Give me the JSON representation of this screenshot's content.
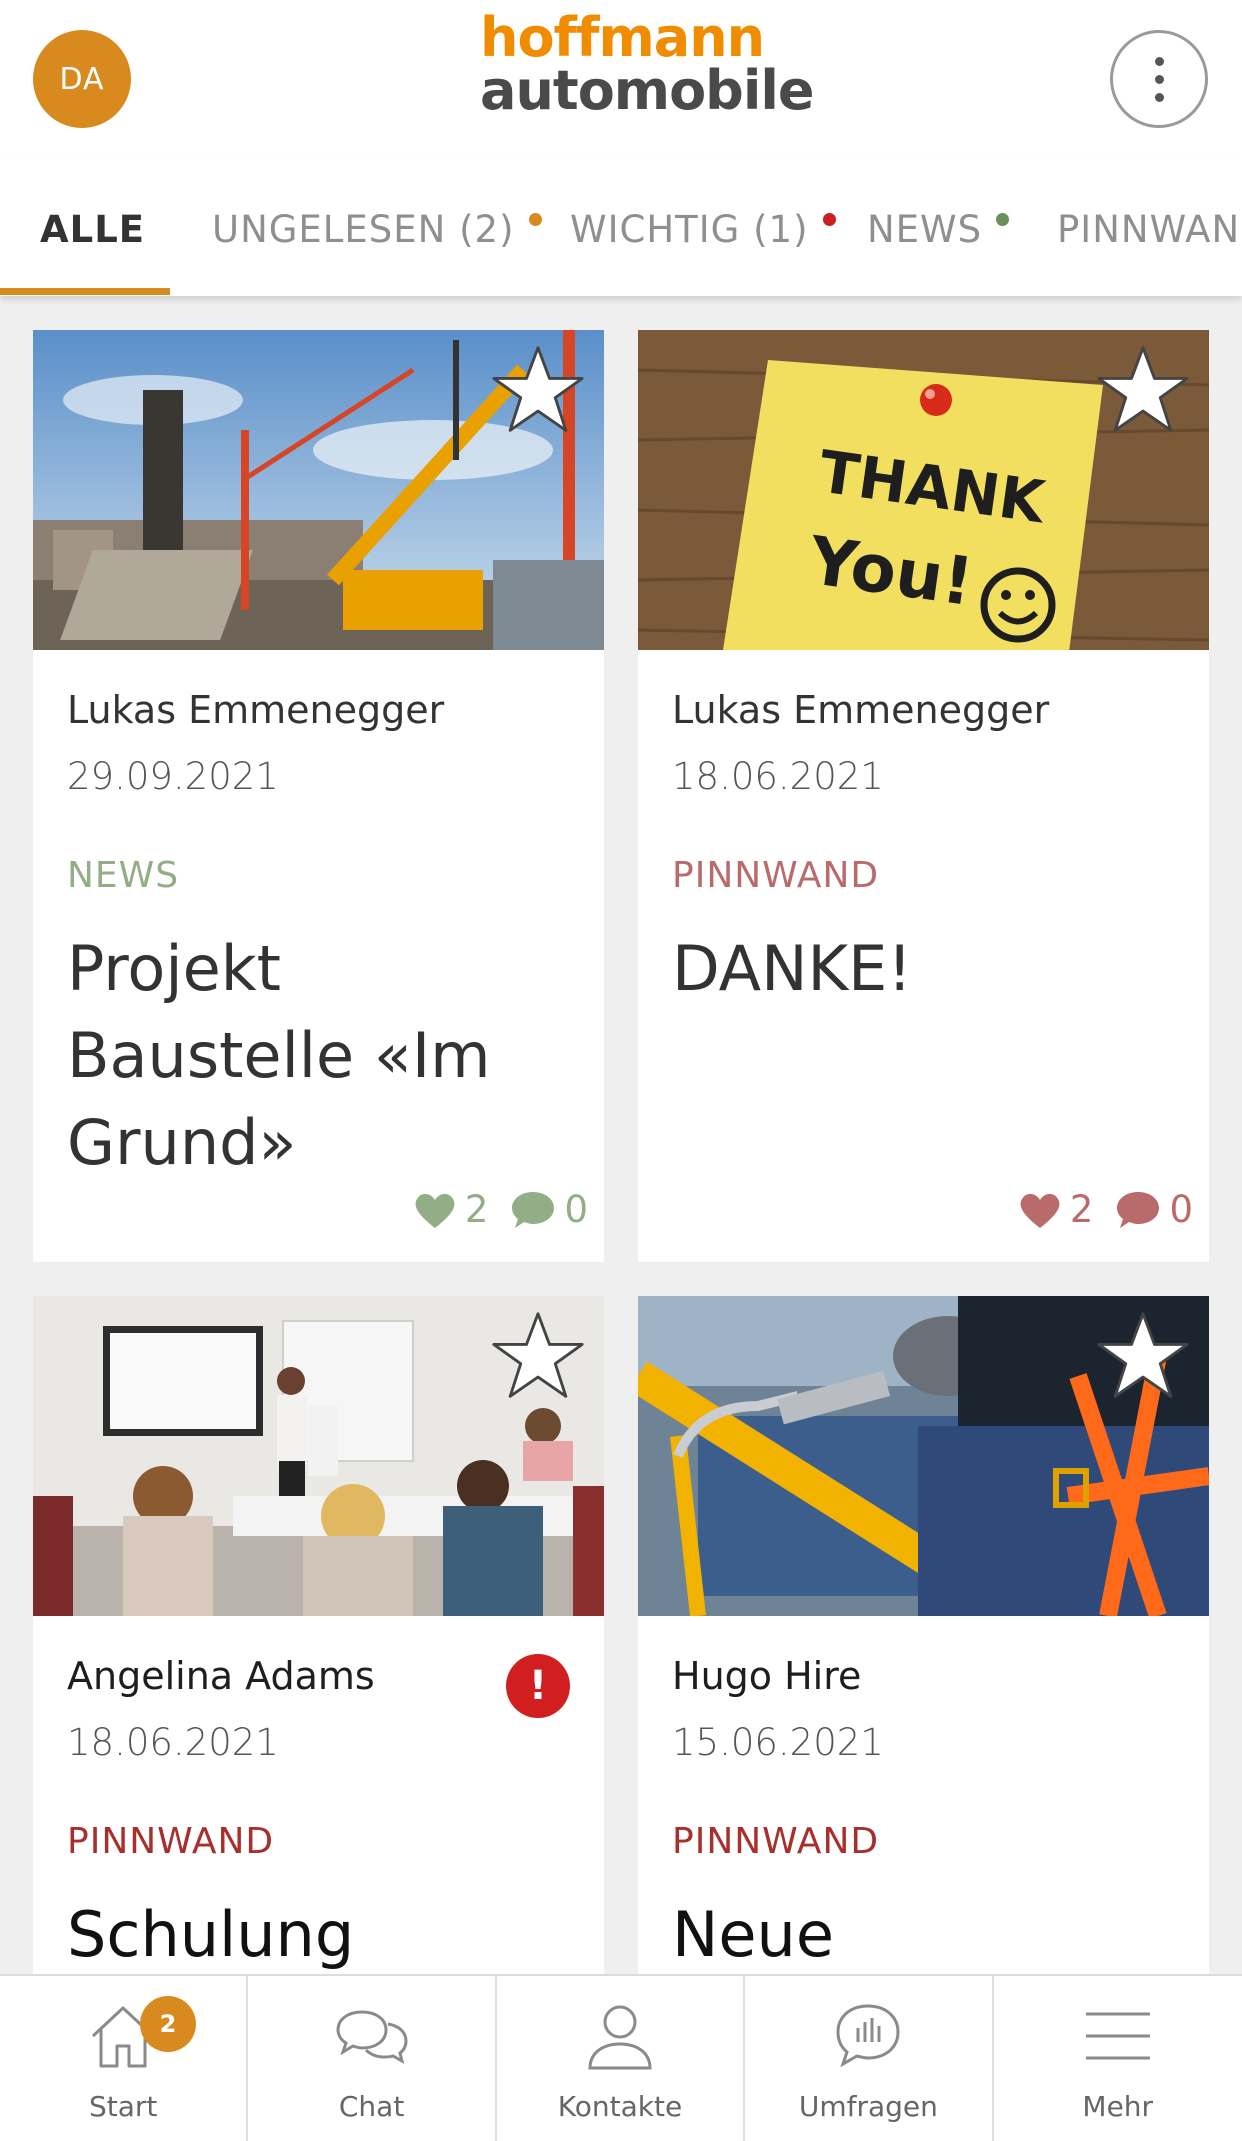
{
  "header": {
    "avatar_initials": "DA",
    "logo_line1": "hoffmann",
    "logo_line2": "automobile"
  },
  "tabs": [
    {
      "label": "ALLE",
      "active": true,
      "dot": null
    },
    {
      "label": "UNGELESEN (2)",
      "active": false,
      "dot": "#d88a1e"
    },
    {
      "label": "WICHTIG (1)",
      "active": false,
      "dot": "#cc1f1f"
    },
    {
      "label": "NEWS",
      "active": false,
      "dot": "#6c8f5a"
    },
    {
      "label": "PINNWAND",
      "active": false,
      "dot": null
    }
  ],
  "cards": [
    {
      "author": "Lukas Emmenegger",
      "date": "29.09.2021",
      "category": "NEWS",
      "category_color": "#93ad86",
      "title": "Projekt Baustelle «Im Grund»",
      "likes": "2",
      "comments": "0",
      "stat_color": "#93ad86",
      "image_icon": "construction-site-image"
    },
    {
      "author": "Lukas Emmenegger",
      "date": "18.06.2021",
      "category": "PINNWAND",
      "category_color": "#b96a6a",
      "title": "DANKE!",
      "likes": "2",
      "comments": "0",
      "stat_color": "#b96a6a",
      "image_icon": "thank-you-note-image",
      "note_line1": "THANK",
      "note_line2": "You!"
    },
    {
      "author": "Angelina Adams",
      "date": "18.06.2021",
      "category": "PINNWAND",
      "category_color": "#a8302c",
      "title": "Schulung",
      "alert": "!",
      "image_icon": "classroom-image"
    },
    {
      "author": "Hugo Hire",
      "date": "15.06.2021",
      "category": "PINNWAND",
      "category_color": "#a8302c",
      "title": "Neue",
      "image_icon": "safety-harness-image"
    }
  ],
  "bottom_nav": [
    {
      "label": "Start",
      "icon": "home-icon",
      "badge": "2"
    },
    {
      "label": "Chat",
      "icon": "chat-icon"
    },
    {
      "label": "Kontakte",
      "icon": "person-icon"
    },
    {
      "label": "Umfragen",
      "icon": "poll-icon"
    },
    {
      "label": "Mehr",
      "icon": "hamburger-icon"
    }
  ]
}
